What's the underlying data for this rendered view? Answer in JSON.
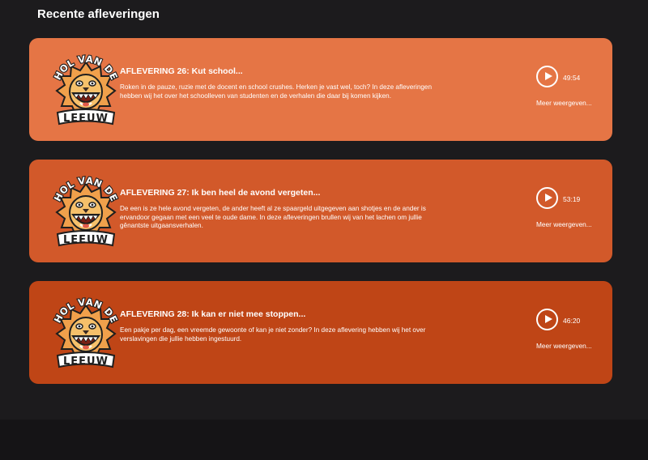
{
  "section": {
    "title": "Recente afleveringen"
  },
  "logo": {
    "line1": "HOL VAN DE",
    "line2": "LEEUW"
  },
  "colors": {
    "page_bg": "#1c1b1d",
    "footer_bg": "#151416"
  },
  "episodes": [
    {
      "title": "AFLEVERING 26: Kut school...",
      "description": "Roken in de pauze, ruzie met de docent en school crushes. Herken je vast wel, toch? In deze afleveringen hebben wij het over het schoolleven van studenten en de verhalen die daar bij komen kijken.",
      "duration": "49:54",
      "more_label": "Meer weergeven...",
      "color": "#e57545"
    },
    {
      "title": "AFLEVERING 27: Ik ben heel de avond vergeten...",
      "description": "De een is ze hele avond vergeten, de ander heeft al ze spaargeld uitgegeven aan shotjes en de ander is ervandoor gegaan met een veel te oude dame. In deze afleveringen brullen wij van het lachen om jullie gênantste uitgaansverhalen.",
      "duration": "53:19",
      "more_label": "Meer weergeven...",
      "color": "#d2592a"
    },
    {
      "title": "AFLEVERING 28: Ik kan er niet mee stoppen...",
      "description": "Een pakje per dag, een vreemde gewoonte of kan je niet zonder? In deze aflevering hebben wij het over verslavingen die jullie hebben ingestuurd.",
      "duration": "46:20",
      "more_label": "Meer weergeven...",
      "color": "#bf4516"
    }
  ]
}
